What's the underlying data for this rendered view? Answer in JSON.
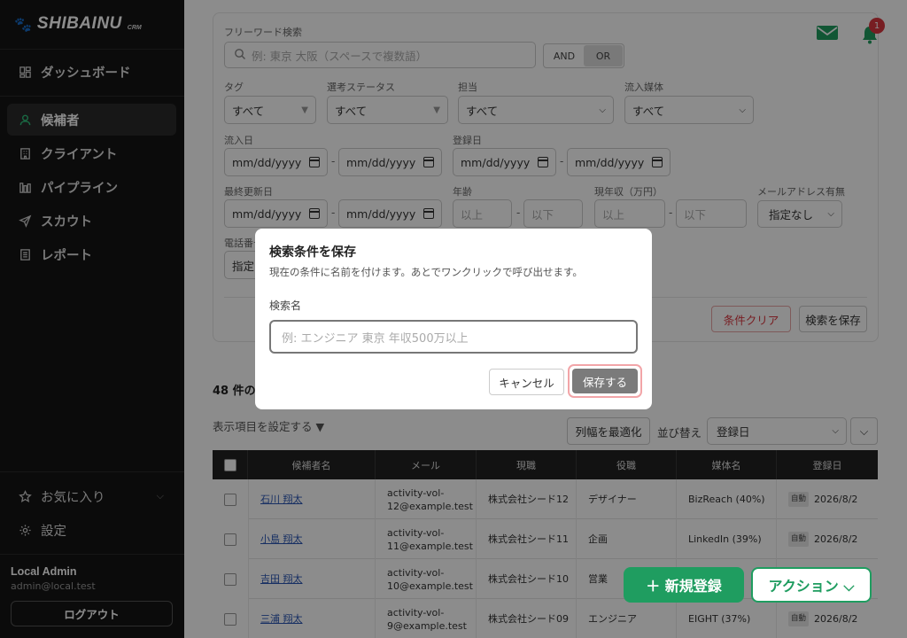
{
  "sidebar": {
    "brand": "SHIBAINU",
    "brand_sub": "CRM",
    "nav": [
      {
        "label": "ダッシュボード"
      },
      {
        "label": "候補者"
      },
      {
        "label": "クライアント"
      },
      {
        "label": "パイプライン"
      },
      {
        "label": "スカウト"
      },
      {
        "label": "レポート"
      }
    ],
    "favorites": "お気に入り",
    "settings": "設定",
    "user_name": "Local Admin",
    "user_email": "admin@local.test",
    "logout": "ログアウト"
  },
  "header": {
    "notification_count": "1"
  },
  "filters": {
    "freeword_label": "フリーワード検索",
    "freeword_placeholder": "例: 東京 大阪（スペースで複数語）",
    "and_label": "AND",
    "or_label": "OR",
    "tag_label": "タグ",
    "tag_value": "すべて",
    "status_label": "選考ステータス",
    "status_value": "すべて",
    "owner_label": "担当",
    "owner_value": "すべて",
    "source_label": "流入媒体",
    "source_value": "すべて",
    "inflow_date_label": "流入日",
    "reg_date_label": "登録日",
    "updated_label": "最終更新日",
    "date_placeholder": "mm/dd/yyyy",
    "age_label": "年齢",
    "income_label": "現年収（万円）",
    "min_placeholder": "以上",
    "max_placeholder": "以下",
    "email_label": "メールアドレス有無",
    "email_value": "指定なし",
    "phone_label": "電話番号",
    "phone_value": "指定",
    "clear_button": "条件クリア",
    "save_button": "検索を保存"
  },
  "results": {
    "count_text": "48 件の",
    "columns_toggle": "表示項目を設定する ▼",
    "fit_button": "列幅を最適化",
    "sort_label": "並び替え",
    "sort_value": "登録日"
  },
  "table": {
    "headers": [
      "候補者名",
      "メール",
      "現職",
      "役職",
      "媒体名",
      "登録日"
    ],
    "rows": [
      {
        "name": "石川 翔太",
        "email": "activity-vol-12@example.test",
        "company": "株式会社シード12",
        "role": "デザイナー",
        "source": "BizReach (40%)",
        "badge": "自動",
        "date": "2026/8/2"
      },
      {
        "name": "小島 翔太",
        "email": "activity-vol-11@example.test",
        "company": "株式会社シード11",
        "role": "企画",
        "source": "LinkedIn (39%)",
        "badge": "自動",
        "date": "2026/8/2"
      },
      {
        "name": "吉田 翔太",
        "email": "activity-vol-10@example.test",
        "company": "株式会社シード10",
        "role": "営業",
        "source": "",
        "badge": "",
        "date": ""
      },
      {
        "name": "三浦 翔太",
        "email": "activity-vol-9@example.test",
        "company": "株式会社シード09",
        "role": "エンジニア",
        "source": "EIGHT (37%)",
        "badge": "自動",
        "date": "2026/8/2"
      }
    ]
  },
  "fab": {
    "new_label": "＋ 新規登録",
    "action_label": "アクション ⌵"
  },
  "modal": {
    "title": "検索条件を保存",
    "subtitle": "現在の条件に名前を付けます。あとでワンクリックで呼び出せます。",
    "field_label": "検索名",
    "placeholder": "例: エンジニア 東京 年収500万以上",
    "cancel": "キャンセル",
    "save": "保存する"
  },
  "colors": {
    "accent": "#1f9d60",
    "sidebar": "#141414",
    "danger": "#d9363e"
  }
}
